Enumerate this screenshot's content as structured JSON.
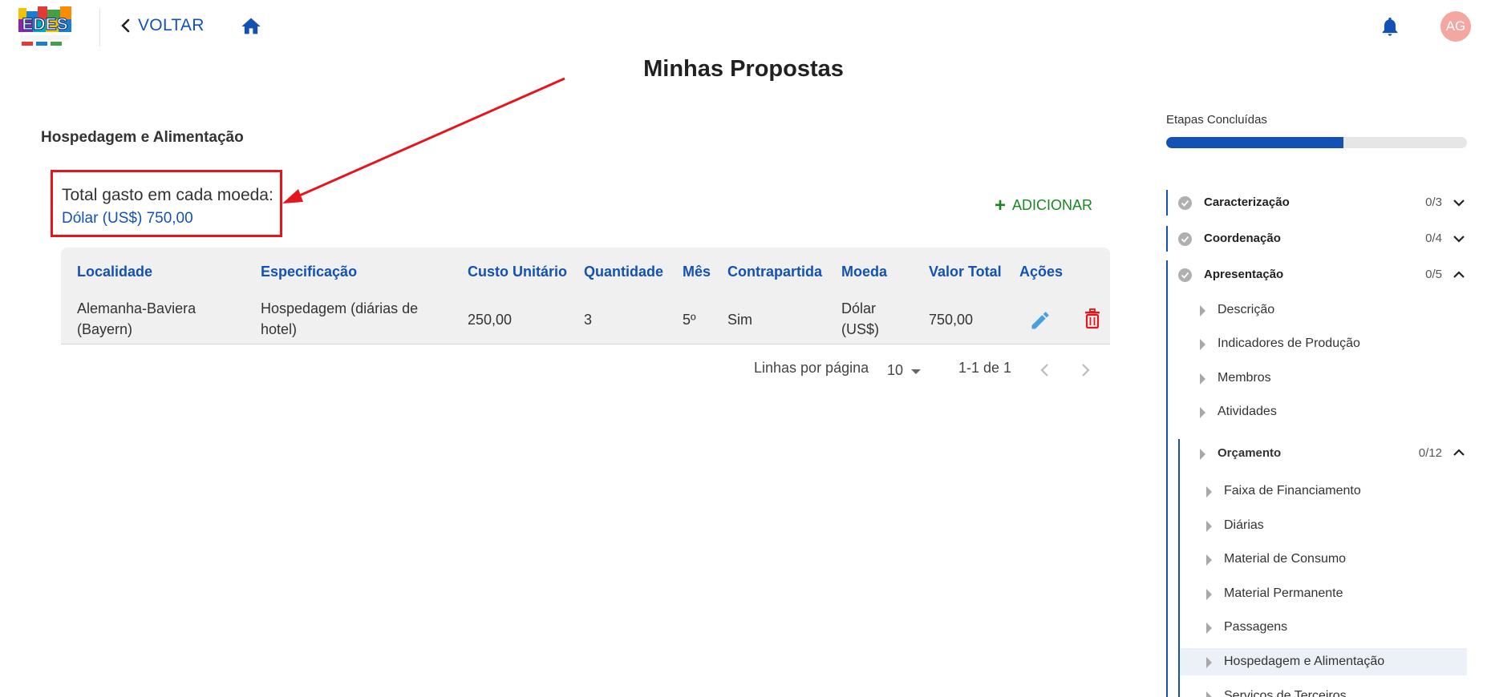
{
  "header": {
    "back_label": "VOLTAR",
    "avatar_initials": "AG",
    "logo_text": "EDES"
  },
  "page_title": "Minhas Propostas",
  "section_title": "Hospedagem e Alimentação",
  "totals": {
    "label": "Total gasto em cada moeda:",
    "value": "Dólar (US$) 750,00"
  },
  "add_label": "ADICIONAR",
  "table": {
    "headers": [
      "Localidade",
      "Especificação",
      "Custo Unitário",
      "Quantidade",
      "Mês",
      "Contrapartida",
      "Moeda",
      "Valor Total",
      "Ações"
    ],
    "rows": [
      {
        "localidade_1": "Alemanha-Baviera",
        "localidade_2": "(Bayern)",
        "especificacao_1": "Hospedagem (diárias de",
        "especificacao_2": "hotel)",
        "custo": "250,00",
        "quantidade": "3",
        "mes": "5º",
        "contrapartida": "Sim",
        "moeda_1": "Dólar",
        "moeda_2": "(US$)",
        "valor_total": "750,00"
      }
    ]
  },
  "pagination": {
    "rows_label": "Linhas por página",
    "rows_value": "10",
    "range": "1-1 de 1"
  },
  "steps_panel": {
    "title": "Etapas Concluídas",
    "progress_fraction": 0.59,
    "steps": [
      {
        "name": "Caracterização",
        "count": "0/3"
      },
      {
        "name": "Coordenação",
        "count": "0/4"
      },
      {
        "name": "Apresentação",
        "count": "0/5"
      }
    ],
    "apresentacao_items": [
      "Descrição",
      "Indicadores de Produção",
      "Membros",
      "Atividades"
    ],
    "orcamento": {
      "name": "Orçamento",
      "count": "0/12"
    },
    "orcamento_items": [
      "Faixa de Financiamento",
      "Diárias",
      "Material de Consumo",
      "Material Permanente",
      "Passagens",
      "Hospedagem e Alimentação",
      "Serviços de Terceiros"
    ]
  },
  "colors": {
    "primary": "#1351b4",
    "success": "#168821",
    "danger": "#e5151d",
    "annotation": "#e5151d"
  }
}
